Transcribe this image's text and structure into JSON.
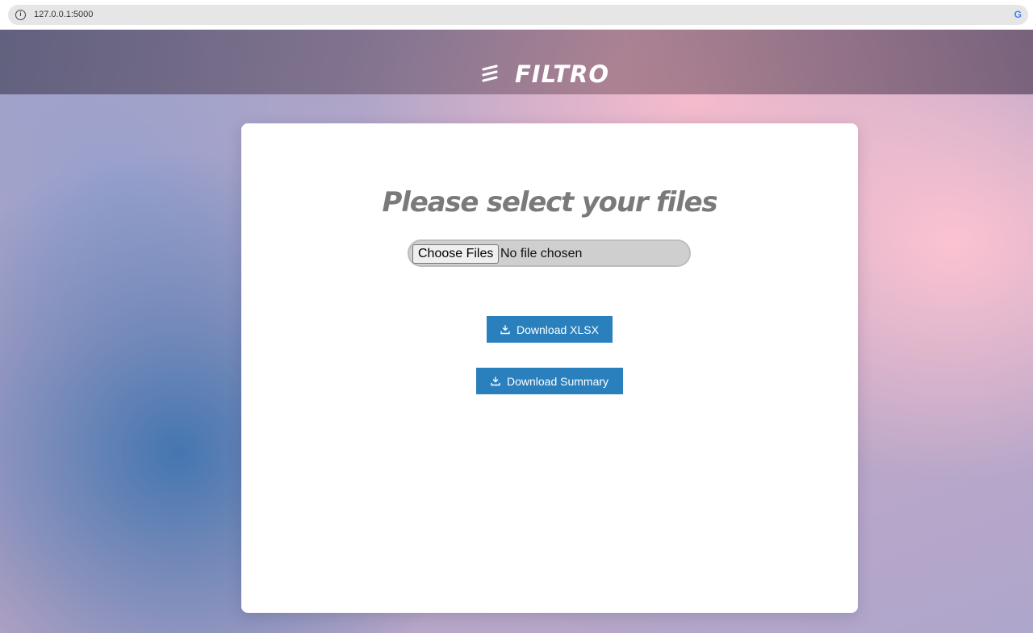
{
  "browser": {
    "url": "127.0.0.1:5000"
  },
  "header": {
    "brand": "FILTRO",
    "logo_icon": "filtro-logo-icon"
  },
  "main": {
    "title": "Please select your files",
    "file_input": {
      "button_label": "Choose Files",
      "status": "No file chosen"
    },
    "buttons": {
      "download_xlsx": "Download XLSX",
      "download_summary": "Download Summary"
    }
  },
  "colors": {
    "button": "#2a80bd",
    "title": "#7a7a7a"
  }
}
